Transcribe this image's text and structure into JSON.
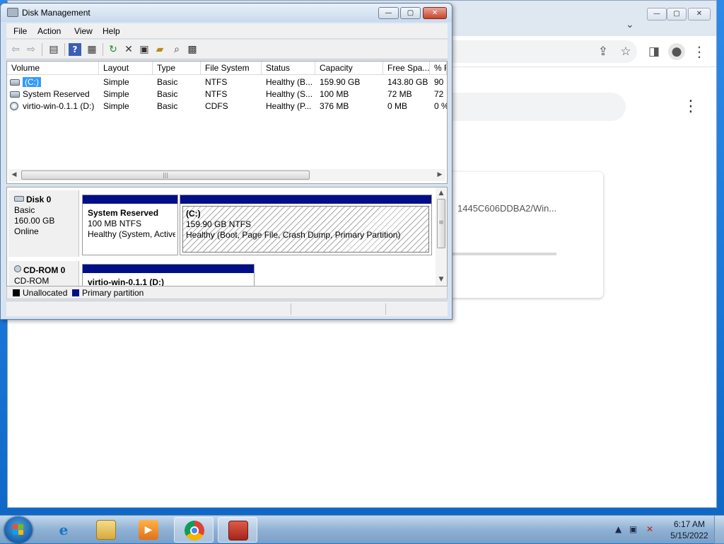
{
  "chrome": {
    "card_text": "1445C606DDBA2/Win...",
    "caption": {
      "minimize": "—",
      "maximize": "▢",
      "close": "✕"
    }
  },
  "dm": {
    "title": "Disk Management",
    "caption": {
      "minimize": "—",
      "maximize": "▢",
      "close": "✕"
    },
    "menu": [
      "File",
      "Action",
      "View",
      "Help"
    ],
    "columns": [
      "Volume",
      "Layout",
      "Type",
      "File System",
      "Status",
      "Capacity",
      "Free Spa...",
      "% F"
    ],
    "volumes": [
      {
        "volume": "(C:)",
        "layout": "Simple",
        "type": "Basic",
        "fs": "NTFS",
        "status": "Healthy (B...",
        "capacity": "159.90 GB",
        "free": "143.80 GB",
        "pct": "90"
      },
      {
        "volume": "System Reserved",
        "layout": "Simple",
        "type": "Basic",
        "fs": "NTFS",
        "status": "Healthy (S...",
        "capacity": "100 MB",
        "free": "72 MB",
        "pct": "72"
      },
      {
        "volume": "virtio-win-0.1.1 (D:)",
        "layout": "Simple",
        "type": "Basic",
        "fs": "CDFS",
        "status": "Healthy (P...",
        "capacity": "376 MB",
        "free": "0 MB",
        "pct": "0 %"
      }
    ],
    "disk0": {
      "name": "Disk 0",
      "type": "Basic",
      "size": "160.00 GB",
      "state": "Online",
      "partitions": [
        {
          "name": "System Reserved",
          "size": "100 MB NTFS",
          "status": "Healthy (System, Active"
        },
        {
          "name": "(C:)",
          "size": "159.90 GB NTFS",
          "status": "Healthy (Boot, Page File, Crash Dump, Primary Partition)"
        }
      ]
    },
    "cdrom0": {
      "name": "CD-ROM 0",
      "type": "CD-ROM",
      "partition": {
        "name": "virtio-win-0.1.1  (D:)"
      }
    },
    "legend": [
      {
        "label": "Unallocated",
        "color": "#000000"
      },
      {
        "label": "Primary partition",
        "color": "#000e88"
      }
    ]
  },
  "taskbar": {
    "time": "6:17 AM",
    "date": "5/15/2022",
    "apps": [
      "internet-explorer",
      "windows-explorer",
      "media-player",
      "google-chrome",
      "computer-management"
    ]
  }
}
